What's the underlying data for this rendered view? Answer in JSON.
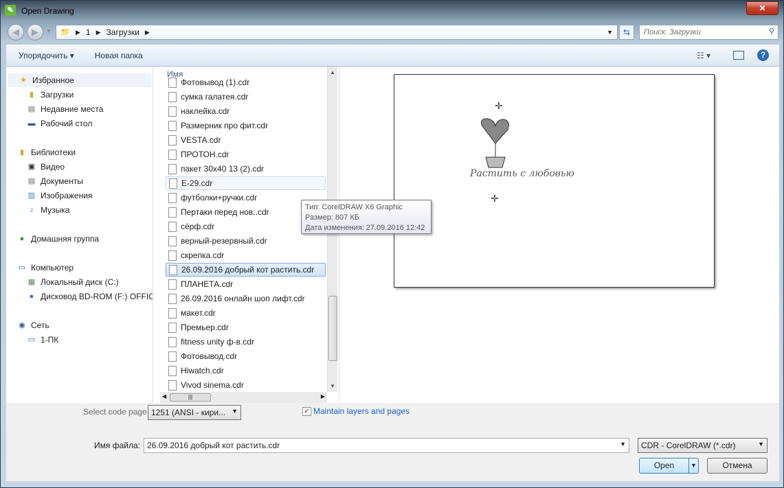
{
  "window": {
    "title": "Open Drawing",
    "close": "✕"
  },
  "address": {
    "crumbs": [
      "1",
      "Загрузки"
    ],
    "search_placeholder": "Поиск: Загрузки"
  },
  "toolbar": {
    "organize": "Упорядочить ▾",
    "new_folder": "Новая папка"
  },
  "nav": {
    "favorites": "Избранное",
    "downloads": "Загрузки",
    "recent": "Недавние места",
    "desktop": "Рабочий стол",
    "libraries": "Библиотеки",
    "video": "Видео",
    "documents": "Документы",
    "images": "Изображения",
    "music": "Музыка",
    "homegroup": "Домашняя группа",
    "computer": "Компьютер",
    "disk_c": "Локальный диск (C:)",
    "disk_f": "Дисковод BD-ROM (F:) OFFICE",
    "network": "Сеть",
    "pc1": "1-ПК"
  },
  "files": {
    "header": "Имя",
    "items": [
      "Фотовывод (1).cdr",
      "сумка галатея.cdr",
      "наклейка.cdr",
      "Размерник про фит.cdr",
      "VESTA.cdr",
      "ПРОТОН.cdr",
      "пакет 30х40 13 (2).cdr",
      "E-29.cdr",
      "футболки+ручки.cdr",
      "Пертаки перед нов..cdr",
      "сёрф.cdr",
      "верный-резервный.cdr",
      "скрепка.cdr",
      "26.09.2016 добрый кот растить.cdr",
      "ПЛАНЕТА.cdr",
      "26.09.2016 онлайн шоп лифт.cdr",
      "макет.cdr",
      "Премьер.cdr",
      "fitness unity ф-в.cdr",
      "Фотовывод.cdr",
      "Hiwatch.cdr",
      "Vivod sinema.cdr"
    ]
  },
  "tooltip": {
    "type": "Тип: CorelDRAW X6 Graphic",
    "size": "Размер: 807 КБ",
    "date": "Дата изменения: 27.09.2016 12:42"
  },
  "preview": {
    "text": "Растить с любовью"
  },
  "bottom": {
    "code_page_label": "Select code page",
    "code_page_value": "1251  (ANSI - кири...",
    "maintain": "Maintain layers and pages",
    "filename_label": "Имя файла:",
    "filename": "26.09.2016 добрый кот растить.cdr",
    "filetype": "CDR - CorelDRAW (*.cdr)",
    "open": "Open",
    "cancel": "Отмена"
  }
}
